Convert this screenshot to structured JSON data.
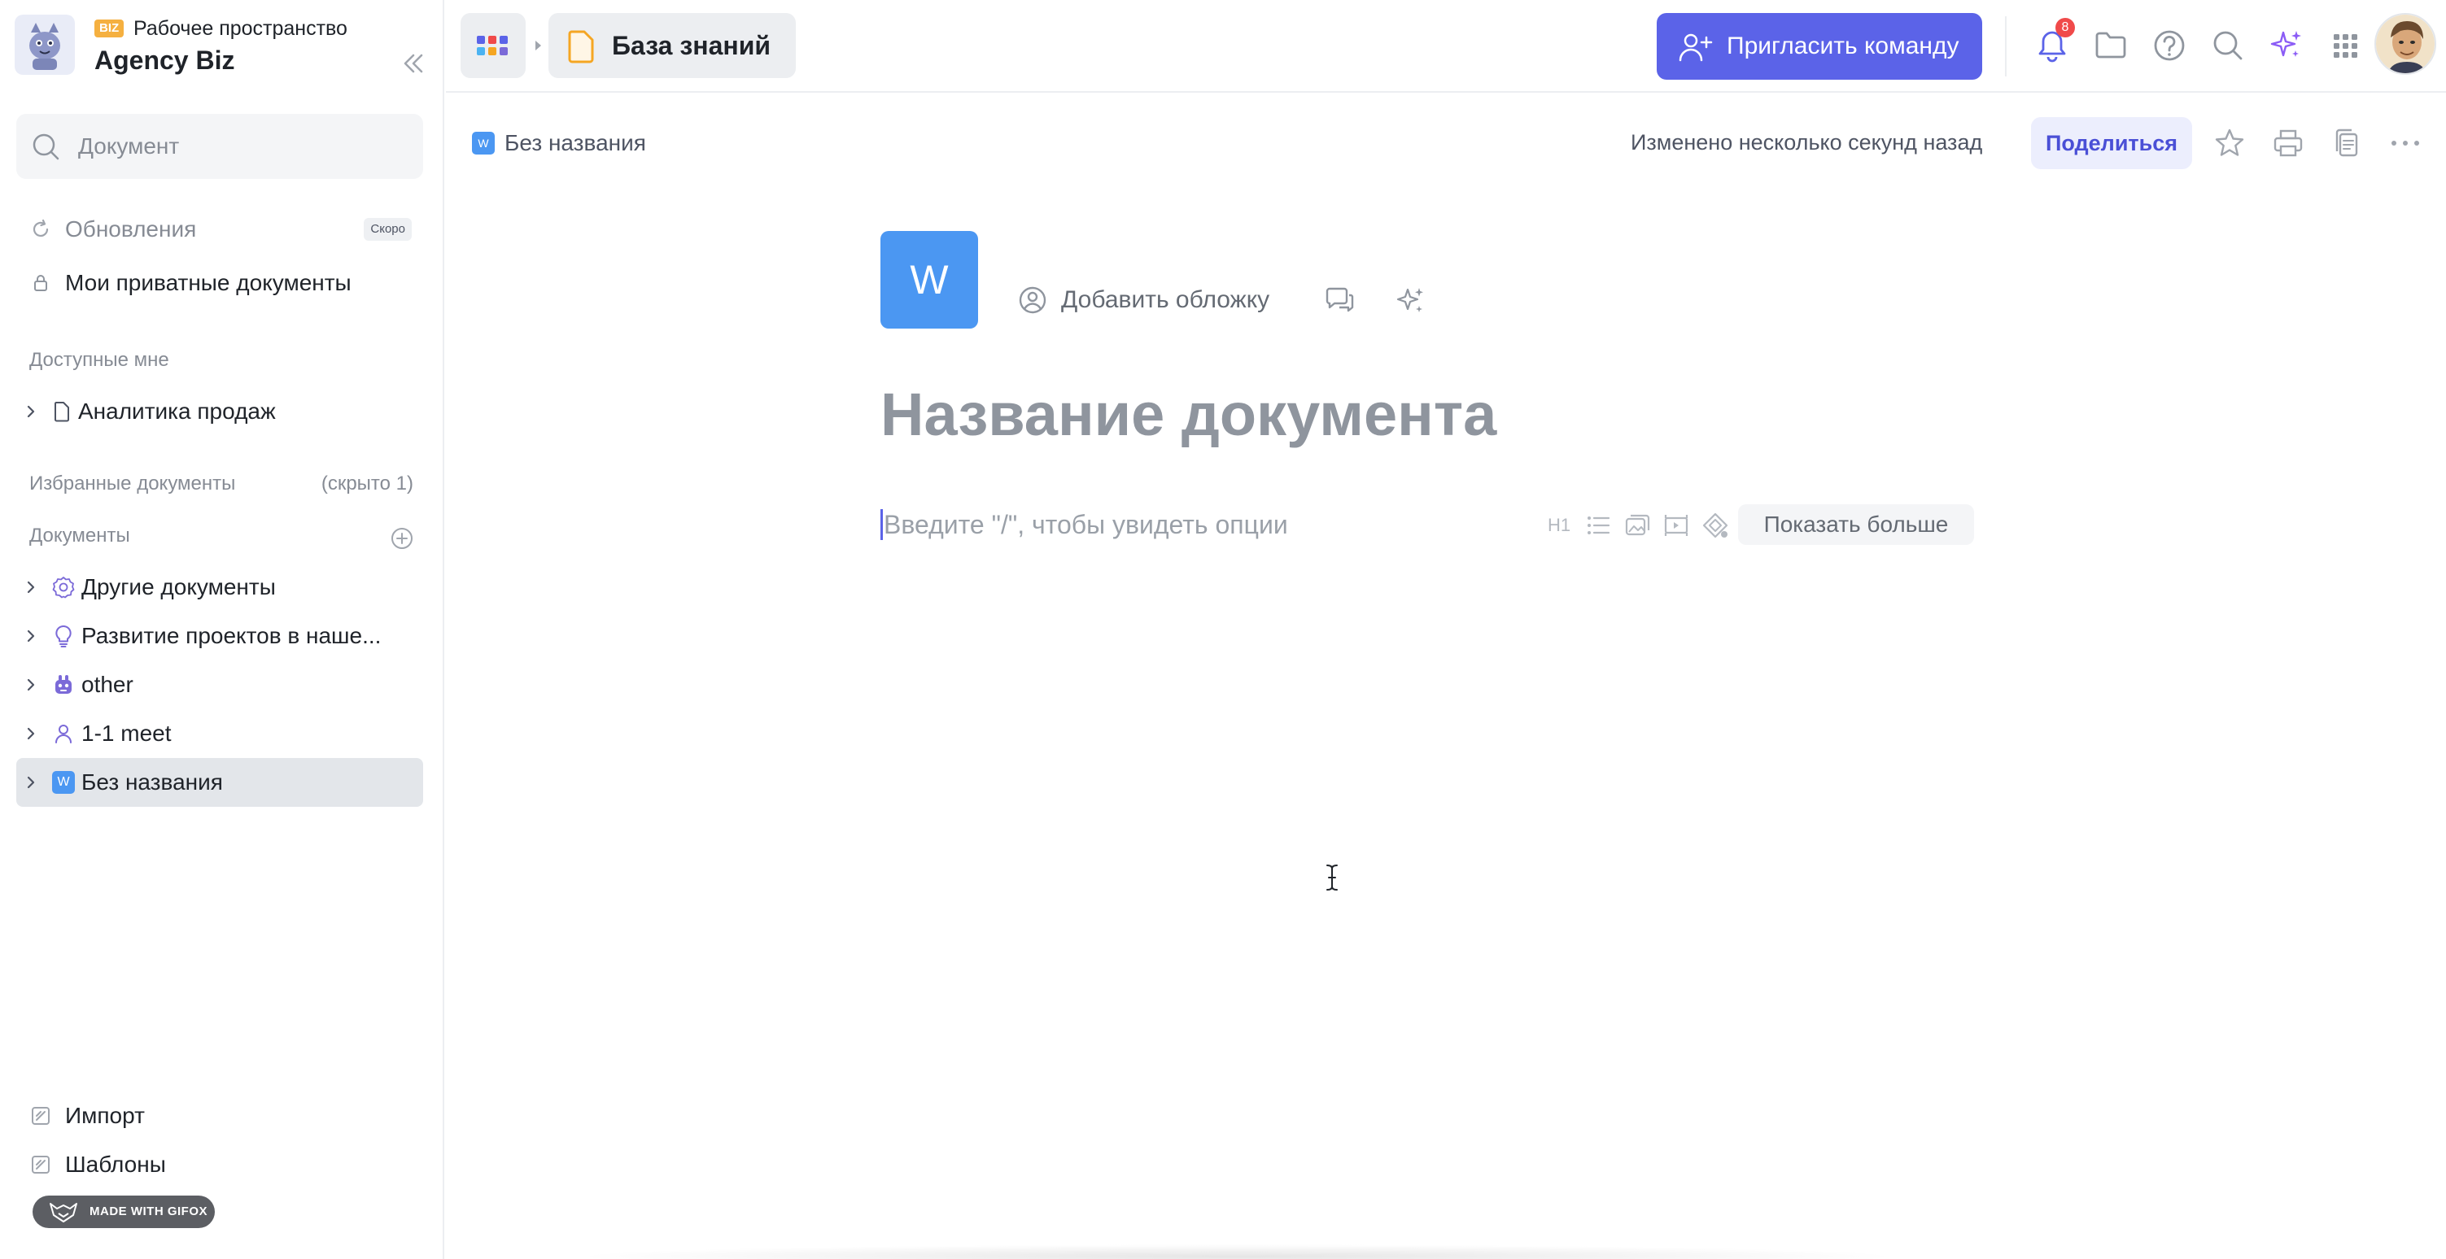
{
  "workspace": {
    "badge": "BIZ",
    "subtitle": "Рабочее пространство",
    "name": "Agency Biz"
  },
  "sidebar": {
    "search_placeholder": "Документ",
    "updates_label": "Обновления",
    "updates_badge": "Скоро",
    "private_label": "Мои приватные документы",
    "shared_section": "Доступные мне",
    "shared_items": [
      {
        "label": "Аналитика продаж"
      }
    ],
    "favorites_section": "Избранные документы",
    "favorites_hidden": "(скрыто 1)",
    "docs_section": "Документы",
    "doc_items": [
      {
        "label": "Другие документы"
      },
      {
        "label": "Развитие проектов в наше..."
      },
      {
        "label": "other"
      },
      {
        "label": "1-1 meet"
      },
      {
        "label": "Без названия",
        "icon_letter": "W"
      }
    ],
    "import_label": "Импорт",
    "templates_label": "Шаблоны",
    "gifox_label": "MADE WITH GIFOX"
  },
  "topbar": {
    "kb_label": "База знаний",
    "invite_label": "Пригласить команду",
    "notifications_count": "8"
  },
  "doc_header": {
    "crumb_letter": "W",
    "crumb_title": "Без названия",
    "changed_text": "Изменено несколько секунд назад",
    "share_label": "Поделиться"
  },
  "editor": {
    "icon_letter": "W",
    "add_cover_label": "Добавить обложку",
    "title_placeholder": "Название документа",
    "body_placeholder": "Введите \"/\", чтобы увидеть опции",
    "h1_label": "H1",
    "show_more_label": "Показать больше"
  },
  "colors": {
    "accent": "#5b63e8",
    "doc_icon": "#4b97f2",
    "notification": "#f04a4a"
  }
}
